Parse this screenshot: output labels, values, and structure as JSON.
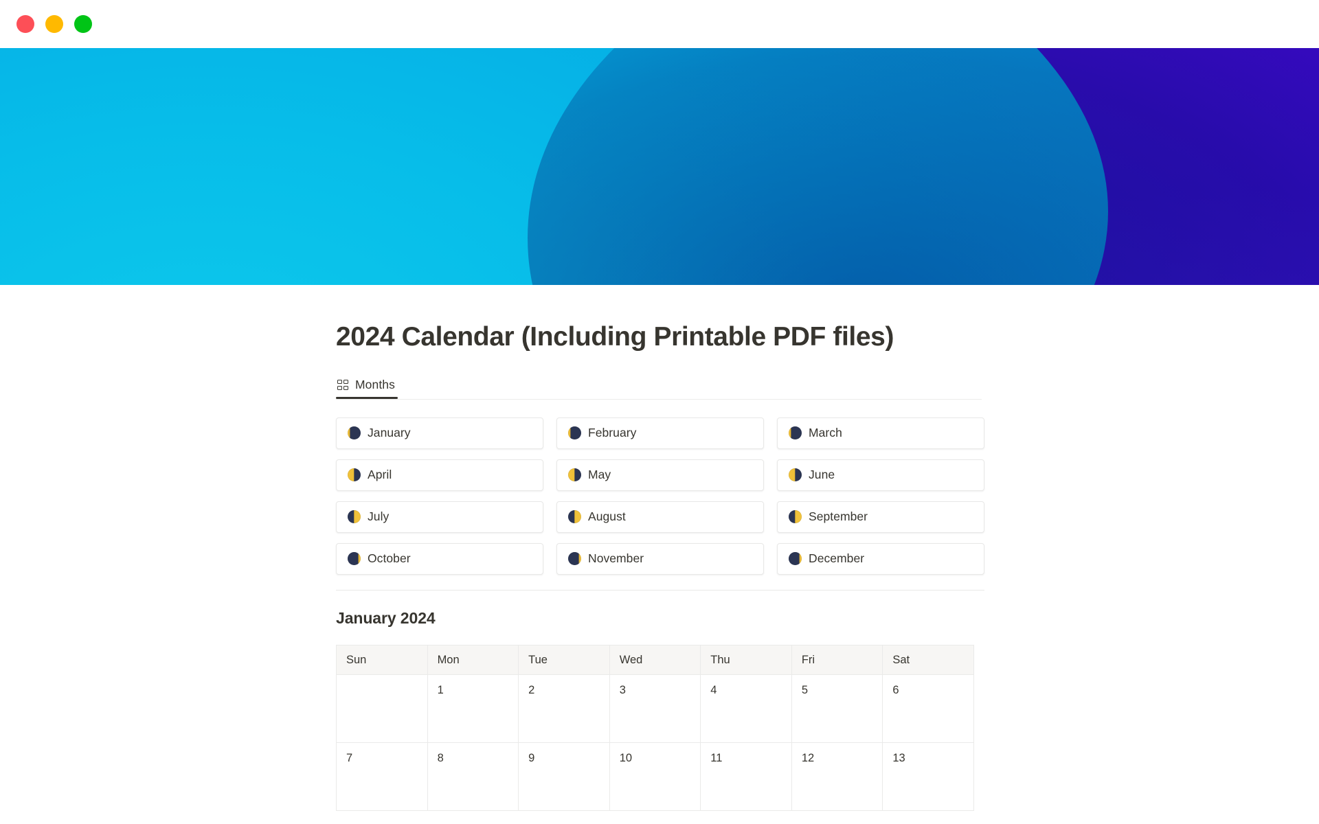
{
  "window": {
    "traffic_lights": [
      {
        "name": "close",
        "color": "#fd4f57"
      },
      {
        "name": "minimize",
        "color": "#ffb900"
      },
      {
        "name": "maximize",
        "color": "#00c416"
      }
    ]
  },
  "hero": {
    "colors": {
      "cyan": "#07bde9",
      "blue": "#0b84d8",
      "indigo": "#3a09c6",
      "purple": "#9410ea",
      "light_purple": "#b348e8"
    }
  },
  "page": {
    "title": "2024 Calendar (Including Printable PDF files)"
  },
  "tabs": [
    {
      "label": "Months",
      "icon": "grid-icon",
      "active": true
    }
  ],
  "months": [
    {
      "name": "January",
      "moon": "waning-crescent"
    },
    {
      "name": "February",
      "moon": "waning-crescent"
    },
    {
      "name": "March",
      "moon": "waning-crescent"
    },
    {
      "name": "April",
      "moon": "last-quarter"
    },
    {
      "name": "May",
      "moon": "last-quarter"
    },
    {
      "name": "June",
      "moon": "last-quarter"
    },
    {
      "name": "July",
      "moon": "first-quarter"
    },
    {
      "name": "August",
      "moon": "first-quarter"
    },
    {
      "name": "September",
      "moon": "first-quarter"
    },
    {
      "name": "October",
      "moon": "waxing-crescent"
    },
    {
      "name": "November",
      "moon": "waxing-crescent"
    },
    {
      "name": "December",
      "moon": "waxing-crescent"
    }
  ],
  "calendar": {
    "heading": "January 2024",
    "day_headers": [
      "Sun",
      "Mon",
      "Tue",
      "Wed",
      "Thu",
      "Fri",
      "Sat"
    ],
    "weeks": [
      [
        "",
        "1",
        "2",
        "3",
        "4",
        "5",
        "6"
      ],
      [
        "7",
        "8",
        "9",
        "10",
        "11",
        "12",
        "13"
      ]
    ]
  }
}
